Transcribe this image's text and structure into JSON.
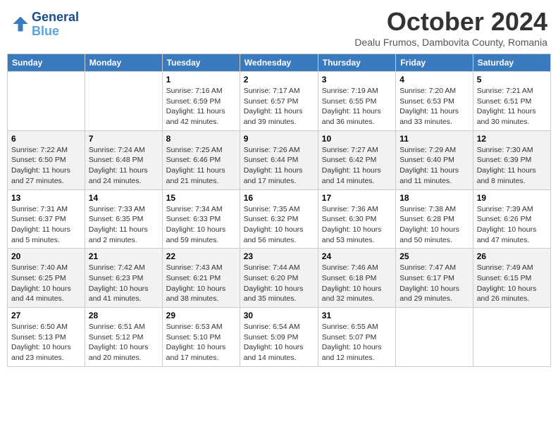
{
  "header": {
    "logo_line1": "General",
    "logo_line2": "Blue",
    "month_title": "October 2024",
    "subtitle": "Dealu Frumos, Dambovita County, Romania"
  },
  "days_of_week": [
    "Sunday",
    "Monday",
    "Tuesday",
    "Wednesday",
    "Thursday",
    "Friday",
    "Saturday"
  ],
  "weeks": [
    [
      {
        "day": "",
        "sunrise": "",
        "sunset": "",
        "daylight": ""
      },
      {
        "day": "",
        "sunrise": "",
        "sunset": "",
        "daylight": ""
      },
      {
        "day": "1",
        "sunrise": "Sunrise: 7:16 AM",
        "sunset": "Sunset: 6:59 PM",
        "daylight": "Daylight: 11 hours and 42 minutes."
      },
      {
        "day": "2",
        "sunrise": "Sunrise: 7:17 AM",
        "sunset": "Sunset: 6:57 PM",
        "daylight": "Daylight: 11 hours and 39 minutes."
      },
      {
        "day": "3",
        "sunrise": "Sunrise: 7:19 AM",
        "sunset": "Sunset: 6:55 PM",
        "daylight": "Daylight: 11 hours and 36 minutes."
      },
      {
        "day": "4",
        "sunrise": "Sunrise: 7:20 AM",
        "sunset": "Sunset: 6:53 PM",
        "daylight": "Daylight: 11 hours and 33 minutes."
      },
      {
        "day": "5",
        "sunrise": "Sunrise: 7:21 AM",
        "sunset": "Sunset: 6:51 PM",
        "daylight": "Daylight: 11 hours and 30 minutes."
      }
    ],
    [
      {
        "day": "6",
        "sunrise": "Sunrise: 7:22 AM",
        "sunset": "Sunset: 6:50 PM",
        "daylight": "Daylight: 11 hours and 27 minutes."
      },
      {
        "day": "7",
        "sunrise": "Sunrise: 7:24 AM",
        "sunset": "Sunset: 6:48 PM",
        "daylight": "Daylight: 11 hours and 24 minutes."
      },
      {
        "day": "8",
        "sunrise": "Sunrise: 7:25 AM",
        "sunset": "Sunset: 6:46 PM",
        "daylight": "Daylight: 11 hours and 21 minutes."
      },
      {
        "day": "9",
        "sunrise": "Sunrise: 7:26 AM",
        "sunset": "Sunset: 6:44 PM",
        "daylight": "Daylight: 11 hours and 17 minutes."
      },
      {
        "day": "10",
        "sunrise": "Sunrise: 7:27 AM",
        "sunset": "Sunset: 6:42 PM",
        "daylight": "Daylight: 11 hours and 14 minutes."
      },
      {
        "day": "11",
        "sunrise": "Sunrise: 7:29 AM",
        "sunset": "Sunset: 6:40 PM",
        "daylight": "Daylight: 11 hours and 11 minutes."
      },
      {
        "day": "12",
        "sunrise": "Sunrise: 7:30 AM",
        "sunset": "Sunset: 6:39 PM",
        "daylight": "Daylight: 11 hours and 8 minutes."
      }
    ],
    [
      {
        "day": "13",
        "sunrise": "Sunrise: 7:31 AM",
        "sunset": "Sunset: 6:37 PM",
        "daylight": "Daylight: 11 hours and 5 minutes."
      },
      {
        "day": "14",
        "sunrise": "Sunrise: 7:33 AM",
        "sunset": "Sunset: 6:35 PM",
        "daylight": "Daylight: 11 hours and 2 minutes."
      },
      {
        "day": "15",
        "sunrise": "Sunrise: 7:34 AM",
        "sunset": "Sunset: 6:33 PM",
        "daylight": "Daylight: 10 hours and 59 minutes."
      },
      {
        "day": "16",
        "sunrise": "Sunrise: 7:35 AM",
        "sunset": "Sunset: 6:32 PM",
        "daylight": "Daylight: 10 hours and 56 minutes."
      },
      {
        "day": "17",
        "sunrise": "Sunrise: 7:36 AM",
        "sunset": "Sunset: 6:30 PM",
        "daylight": "Daylight: 10 hours and 53 minutes."
      },
      {
        "day": "18",
        "sunrise": "Sunrise: 7:38 AM",
        "sunset": "Sunset: 6:28 PM",
        "daylight": "Daylight: 10 hours and 50 minutes."
      },
      {
        "day": "19",
        "sunrise": "Sunrise: 7:39 AM",
        "sunset": "Sunset: 6:26 PM",
        "daylight": "Daylight: 10 hours and 47 minutes."
      }
    ],
    [
      {
        "day": "20",
        "sunrise": "Sunrise: 7:40 AM",
        "sunset": "Sunset: 6:25 PM",
        "daylight": "Daylight: 10 hours and 44 minutes."
      },
      {
        "day": "21",
        "sunrise": "Sunrise: 7:42 AM",
        "sunset": "Sunset: 6:23 PM",
        "daylight": "Daylight: 10 hours and 41 minutes."
      },
      {
        "day": "22",
        "sunrise": "Sunrise: 7:43 AM",
        "sunset": "Sunset: 6:21 PM",
        "daylight": "Daylight: 10 hours and 38 minutes."
      },
      {
        "day": "23",
        "sunrise": "Sunrise: 7:44 AM",
        "sunset": "Sunset: 6:20 PM",
        "daylight": "Daylight: 10 hours and 35 minutes."
      },
      {
        "day": "24",
        "sunrise": "Sunrise: 7:46 AM",
        "sunset": "Sunset: 6:18 PM",
        "daylight": "Daylight: 10 hours and 32 minutes."
      },
      {
        "day": "25",
        "sunrise": "Sunrise: 7:47 AM",
        "sunset": "Sunset: 6:17 PM",
        "daylight": "Daylight: 10 hours and 29 minutes."
      },
      {
        "day": "26",
        "sunrise": "Sunrise: 7:49 AM",
        "sunset": "Sunset: 6:15 PM",
        "daylight": "Daylight: 10 hours and 26 minutes."
      }
    ],
    [
      {
        "day": "27",
        "sunrise": "Sunrise: 6:50 AM",
        "sunset": "Sunset: 5:13 PM",
        "daylight": "Daylight: 10 hours and 23 minutes."
      },
      {
        "day": "28",
        "sunrise": "Sunrise: 6:51 AM",
        "sunset": "Sunset: 5:12 PM",
        "daylight": "Daylight: 10 hours and 20 minutes."
      },
      {
        "day": "29",
        "sunrise": "Sunrise: 6:53 AM",
        "sunset": "Sunset: 5:10 PM",
        "daylight": "Daylight: 10 hours and 17 minutes."
      },
      {
        "day": "30",
        "sunrise": "Sunrise: 6:54 AM",
        "sunset": "Sunset: 5:09 PM",
        "daylight": "Daylight: 10 hours and 14 minutes."
      },
      {
        "day": "31",
        "sunrise": "Sunrise: 6:55 AM",
        "sunset": "Sunset: 5:07 PM",
        "daylight": "Daylight: 10 hours and 12 minutes."
      },
      {
        "day": "",
        "sunrise": "",
        "sunset": "",
        "daylight": ""
      },
      {
        "day": "",
        "sunrise": "",
        "sunset": "",
        "daylight": ""
      }
    ]
  ]
}
